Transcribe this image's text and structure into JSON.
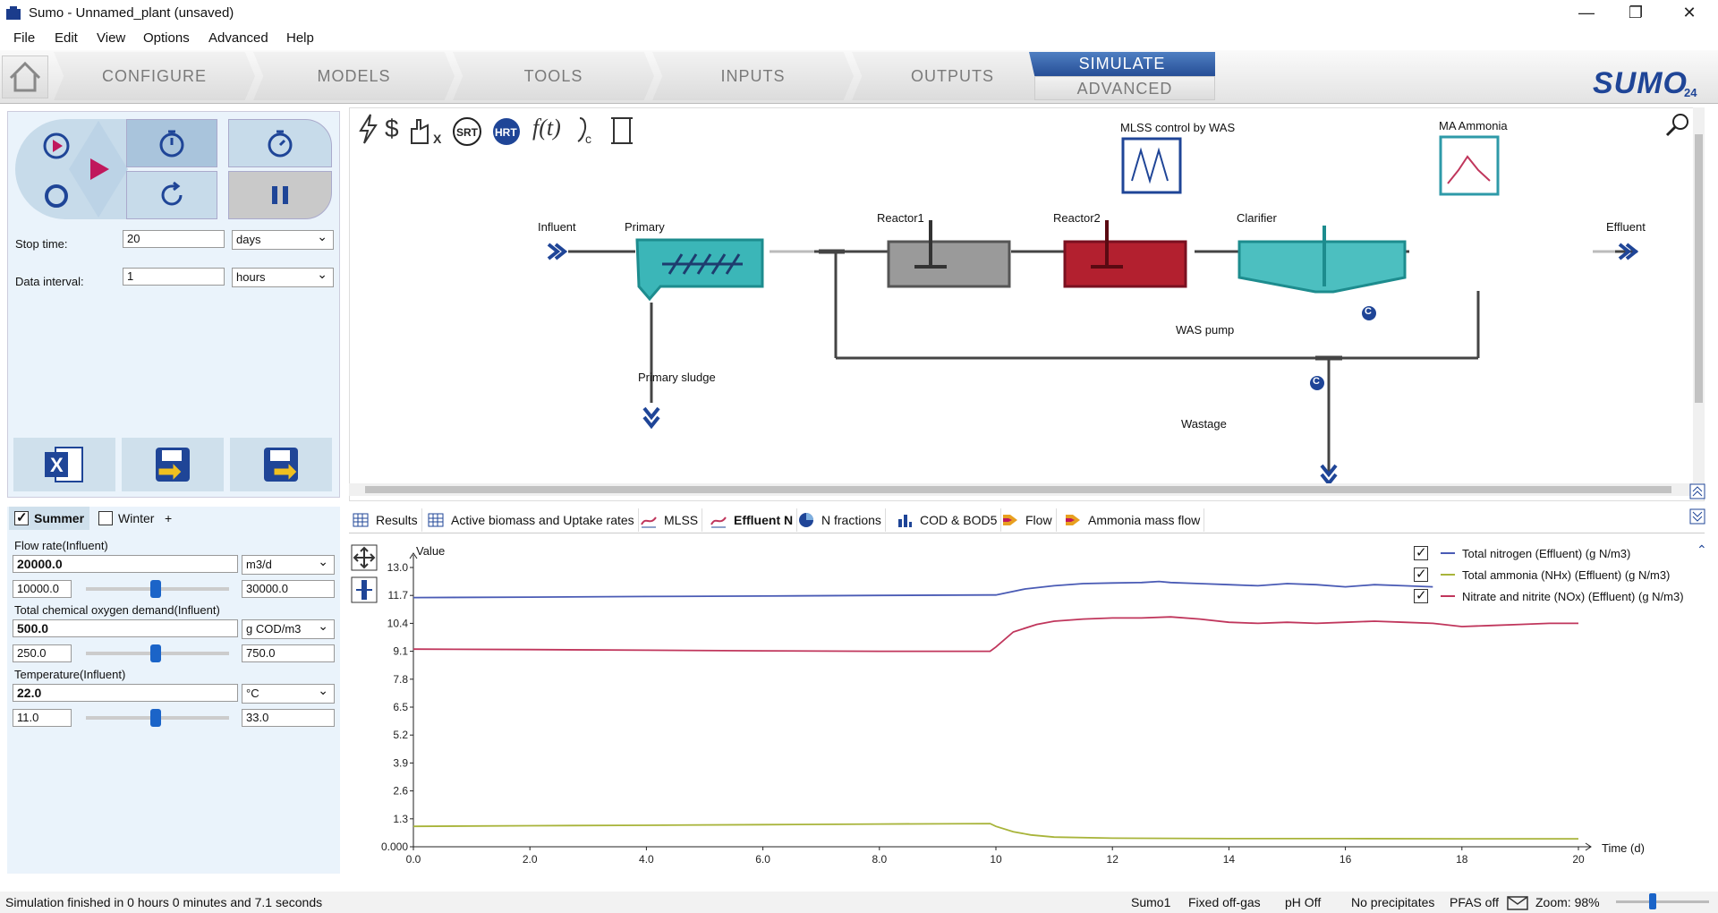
{
  "window": {
    "title": "Sumo - Unnamed_plant (unsaved)",
    "minimize": "—",
    "restore": "❐",
    "close": "✕"
  },
  "menu": [
    "File",
    "Edit",
    "View",
    "Options",
    "Advanced",
    "Help"
  ],
  "nav": {
    "tabs": [
      "CONFIGURE",
      "MODELS",
      "TOOLS",
      "INPUTS",
      "OUTPUTS"
    ],
    "simulate": "SIMULATE",
    "advanced": "ADVANCED",
    "logo": "SUMO",
    "logo_sub": "24"
  },
  "sim": {
    "stop_time_label": "Stop time:",
    "stop_time_value": "20",
    "stop_time_unit": "days",
    "data_interval_label": "Data interval:",
    "data_interval_value": "1",
    "data_interval_unit": "hours"
  },
  "flowsheet": {
    "labels": {
      "influent": "Influent",
      "primary": "Primary",
      "reactor1": "Reactor1",
      "reactor2": "Reactor2",
      "clarifier": "Clarifier",
      "effluent": "Effluent",
      "primary_sludge": "Primary sludge",
      "was_pump": "WAS pump",
      "wastage": "Wastage",
      "mlss_control": "MLSS control by WAS",
      "ma_ammonia": "MA Ammonia"
    },
    "c_badge": "C"
  },
  "scenarios": {
    "tabs": [
      {
        "label": "Summer",
        "checked": true
      },
      {
        "label": "Winter",
        "checked": false
      }
    ],
    "add": "+"
  },
  "params": [
    {
      "label": "Flow rate(Influent)",
      "value": "20000.0",
      "unit": "m3/d",
      "min": "10000.0",
      "max": "30000.0",
      "level": 0.5
    },
    {
      "label": "Total chemical oxygen demand(Influent)",
      "value": "500.0",
      "unit": "g COD/m3",
      "min": "250.0",
      "max": "750.0",
      "level": 0.5
    },
    {
      "label": "Temperature(Influent)",
      "value": "22.0",
      "unit": "°C",
      "min": "11.0",
      "max": "33.0",
      "level": 0.5
    }
  ],
  "result_tabs": [
    "Results",
    "Active biomass and Uptake rates",
    "MLSS",
    "Effluent N",
    "N fractions",
    "COD & BOD5",
    "Flow",
    "Ammonia mass flow"
  ],
  "active_result_tab": "Effluent N",
  "chart_data": {
    "type": "line",
    "ylabel": "Value",
    "xlabel": "Time  (d)",
    "xlim": [
      0,
      20
    ],
    "ylim": [
      0,
      13.0
    ],
    "yticks": [
      "0.000",
      "1.3",
      "2.6",
      "3.9",
      "5.2",
      "6.5",
      "7.8",
      "9.1",
      "10.4",
      "11.7",
      "13.0"
    ],
    "xticks": [
      "0.0",
      "2.0",
      "4.0",
      "6.0",
      "8.0",
      "10",
      "12",
      "14",
      "16",
      "18",
      "20"
    ],
    "legend_position": "top-right",
    "series": [
      {
        "name": "Total nitrogen (Effluent) (g N/m3)",
        "color": "#4a5bb5",
        "x": [
          0,
          2,
          4,
          6,
          8,
          9.9,
          10,
          10.5,
          11,
          11.5,
          12,
          12.5,
          12.8,
          13,
          13.5,
          14,
          14.5,
          15,
          15.5,
          16,
          16.5,
          17,
          17.5
        ],
        "y": [
          11.6,
          11.62,
          11.65,
          11.67,
          11.7,
          11.72,
          11.72,
          12.0,
          12.15,
          12.25,
          12.28,
          12.3,
          12.35,
          12.3,
          12.25,
          12.2,
          12.15,
          12.25,
          12.2,
          12.1,
          12.2,
          12.15,
          12.1
        ]
      },
      {
        "name": "Total ammonia (NHx) (Effluent) (g N/m3)",
        "color": "#a8b43a",
        "x": [
          0,
          2,
          4,
          6,
          8,
          9.9,
          10,
          10.3,
          10.6,
          11,
          12,
          14,
          16,
          18,
          20
        ],
        "y": [
          0.95,
          0.98,
          1.0,
          1.03,
          1.06,
          1.08,
          0.95,
          0.7,
          0.55,
          0.45,
          0.4,
          0.38,
          0.38,
          0.37,
          0.37
        ]
      },
      {
        "name": "Nitrate and nitrite (NOx) (Effluent) (g N/m3)",
        "color": "#c0365c",
        "x": [
          0,
          2,
          4,
          6,
          8,
          9.9,
          10,
          10.3,
          10.7,
          11,
          11.5,
          12,
          12.5,
          13,
          13.5,
          14,
          14.5,
          15,
          15.5,
          16,
          16.5,
          17,
          17.5,
          18,
          18.5,
          19,
          19.5,
          20
        ],
        "y": [
          9.2,
          9.18,
          9.15,
          9.12,
          9.1,
          9.1,
          9.3,
          10.0,
          10.35,
          10.5,
          10.6,
          10.65,
          10.65,
          10.7,
          10.6,
          10.45,
          10.4,
          10.45,
          10.4,
          10.45,
          10.5,
          10.45,
          10.4,
          10.25,
          10.3,
          10.35,
          10.4,
          10.4
        ]
      }
    ]
  },
  "status": {
    "message": "Simulation finished in 0 hours 0 minutes and 7.1 seconds",
    "model": "Sumo1",
    "offgas": "Fixed off-gas",
    "ph": "pH Off",
    "precip": "No precipitates",
    "pfas": "PFAS off",
    "zoom": "Zoom: 98%"
  }
}
